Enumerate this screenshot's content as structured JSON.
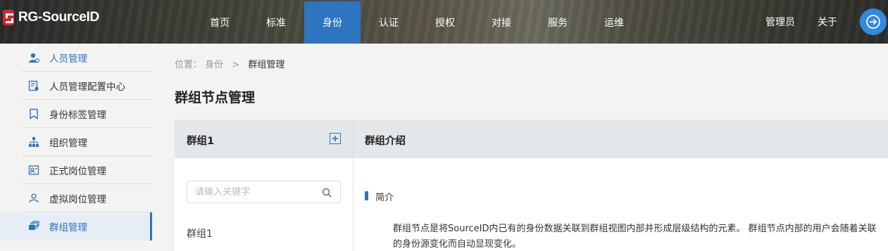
{
  "brand": {
    "name": "RG-SourceID"
  },
  "nav": {
    "items": [
      {
        "label": "首页",
        "active": false
      },
      {
        "label": "标准",
        "active": false
      },
      {
        "label": "身份",
        "active": true
      },
      {
        "label": "认证",
        "active": false
      },
      {
        "label": "授权",
        "active": false
      },
      {
        "label": "对接",
        "active": false
      },
      {
        "label": "服务",
        "active": false
      },
      {
        "label": "运维",
        "active": false
      }
    ],
    "admin_label": "管理员",
    "about_label": "关于",
    "logout_icon": "logout-icon"
  },
  "sidebar": {
    "items": [
      {
        "label": "人员管理",
        "icon": "person-icon"
      },
      {
        "label": "人员管理配置中心",
        "icon": "config-icon"
      },
      {
        "label": "身份标签管理",
        "icon": "bookmark-icon"
      },
      {
        "label": "组织管理",
        "icon": "org-icon"
      },
      {
        "label": "正式岗位管理",
        "icon": "id-card-icon"
      },
      {
        "label": "虚拟岗位管理",
        "icon": "virtual-person-icon"
      },
      {
        "label": "群组管理",
        "icon": "group-icon"
      }
    ]
  },
  "breadcrumb": {
    "prefix": "位置：",
    "parent": "身份",
    "separator": ">",
    "current": "群组管理"
  },
  "page": {
    "title": "群组节点管理"
  },
  "left_panel": {
    "title": "群组1",
    "search_placeholder": "请输入关键字",
    "groups": [
      "群组1"
    ]
  },
  "right_panel": {
    "title": "群组介绍",
    "section_label": "简介",
    "description": "群组节点是将SourceID内已有的身份数据关联到群组视图内部并形成层级结构的元素。 群组节点内部的用户会随着关联的身份源变化而自动显现变化。"
  },
  "colors": {
    "accent": "#2f74c0",
    "brand_red": "#d7262e"
  }
}
